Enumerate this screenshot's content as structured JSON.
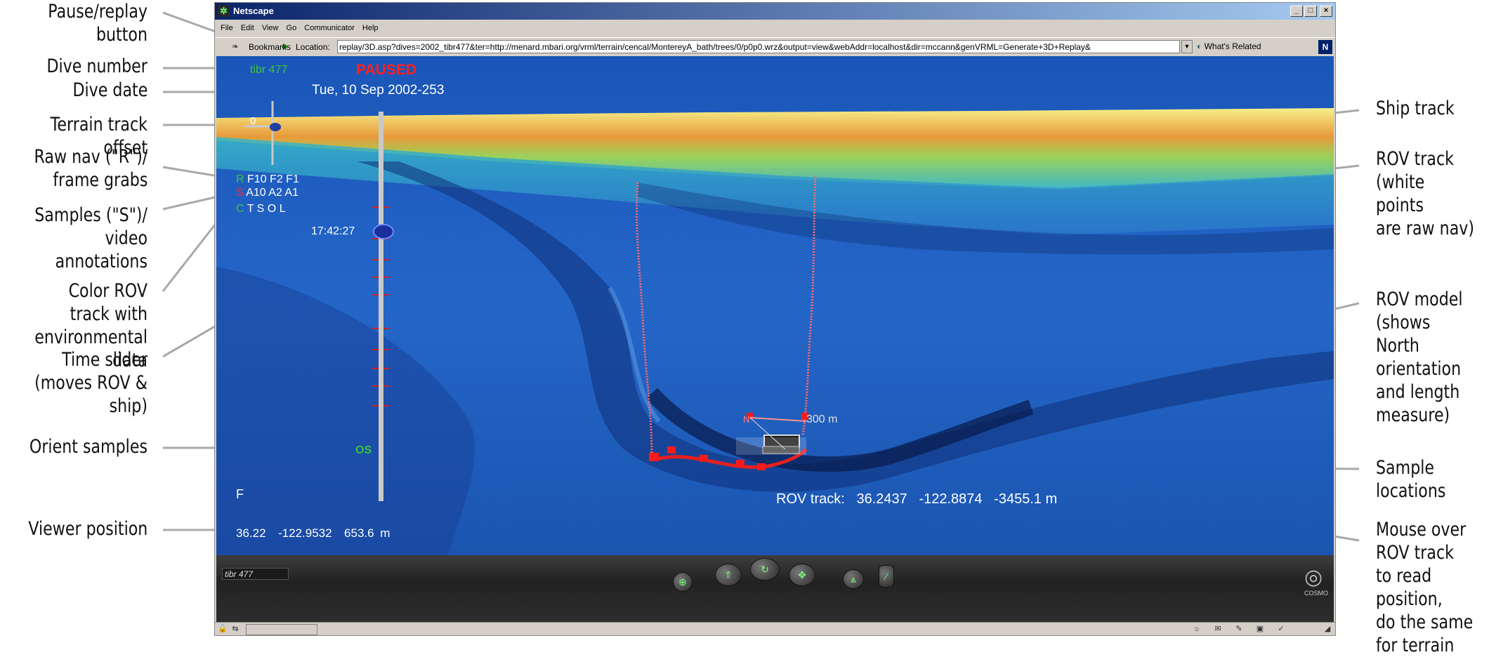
{
  "annotations_left": [
    {
      "id": "pause-replay",
      "text": "Pause/replay button"
    },
    {
      "id": "dive-number",
      "text": "Dive number"
    },
    {
      "id": "dive-date",
      "text": "Dive date"
    },
    {
      "id": "terrain-offset",
      "text": "Terrain track offset"
    },
    {
      "id": "raw-nav",
      "line1": "Raw nav (\"R\")/",
      "line2": "frame grabs"
    },
    {
      "id": "samples",
      "line1": "Samples (\"S\")/",
      "line2": "video annotations"
    },
    {
      "id": "color-rov",
      "line1": "Color ROV track with",
      "line2": "environmental data"
    },
    {
      "id": "time-slider",
      "line1": "Time slider",
      "line2": "(moves ROV & ship)"
    },
    {
      "id": "orient-samples",
      "text": "Orient samples"
    },
    {
      "id": "viewer-position",
      "text": "Viewer position"
    }
  ],
  "annotations_right": {
    "ship_track": "Ship track",
    "rov_track": [
      "ROV track",
      "(white points",
      "are raw nav)"
    ],
    "rov_model": [
      "ROV model",
      "(shows North",
      "orientation",
      "and length",
      "measure)"
    ],
    "sample_locations": "Sample locations",
    "mouse_over": [
      "Mouse over",
      "ROV track",
      "to read position,",
      "do the same",
      "for terrain"
    ]
  },
  "window": {
    "title": "Netscape",
    "controls": {
      "minimize": "_",
      "maximize": "□",
      "close": "×"
    },
    "menu": [
      "File",
      "Edit",
      "View",
      "Go",
      "Communicator",
      "Help"
    ],
    "bookmarks_label": "Bookmarks",
    "location_label": "Location:",
    "location_url": "replay/3D.asp?dives=2002_tibr477&ter=http://menard.mbari.org/vrml/terrain/cencal/MontereyA_bath/trees/0/p0p0.wrz&output=view&webAddr=localhost&dir=mccann&genVRML=Generate+3D+Replay&",
    "whats_related": "What's Related",
    "netscape_badge": "N"
  },
  "viewer": {
    "status": "PAUSED",
    "dive_number": "tibr 477",
    "dive_date": "Tue, 10 Sep 2002-253",
    "terrain_offset": "0",
    "raw_nav_row": {
      "key": "R",
      "items": [
        "F10",
        "F2",
        "F1"
      ]
    },
    "samples_row": {
      "key": "S",
      "items": [
        "A10",
        "A2",
        "A1"
      ]
    },
    "color_row": {
      "key": "C",
      "items": [
        "T",
        "S",
        "O",
        "L"
      ]
    },
    "time_label": "17:42:27",
    "orient_samples": "OS",
    "f_label": "F",
    "viewer_position": {
      "lat": "36.22",
      "lon": "-122.9532",
      "depth": "653.6 m"
    },
    "scale_label": "300 m",
    "north_label": "N",
    "rov_track_readout": {
      "label": "ROV track:",
      "lat": "36.2437",
      "lon": "-122.8874",
      "depth": "-3455.1 m"
    }
  },
  "cosmo": {
    "name_field": "tibr 477",
    "logo": "COSMO"
  },
  "colors": {
    "paused": "#ff2020",
    "dive_number": "#3ec23e",
    "sample_markers": "#ff1a1a",
    "slider_ticks": "#d02020"
  }
}
